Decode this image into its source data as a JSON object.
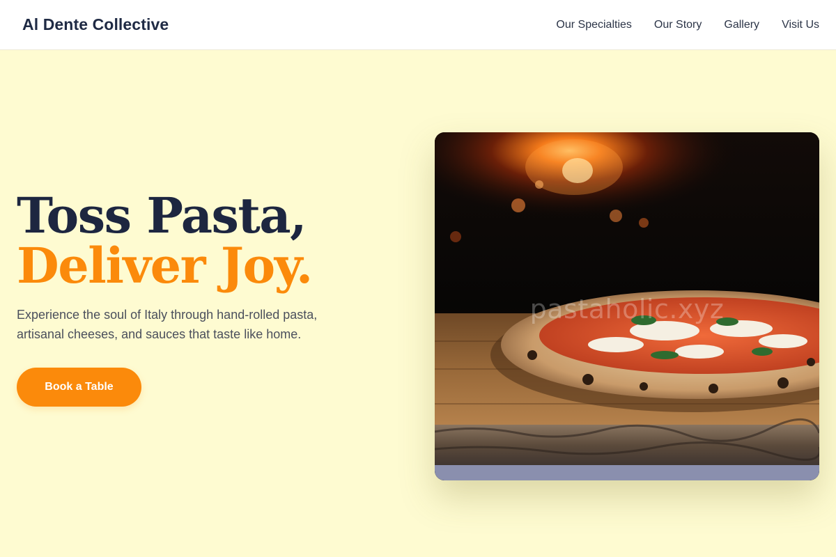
{
  "header": {
    "brand": "Al Dente Collective",
    "nav": [
      "Our Specialties",
      "Our Story",
      "Gallery",
      "Visit Us"
    ]
  },
  "hero": {
    "headline_line1": "Toss Pasta,",
    "headline_line2": "Deliver Joy.",
    "subtext": "Experience the soul of Italy through hand-rolled pasta, artisanal cheeses, and sauces that taste like home.",
    "cta_label": "Book a Table",
    "image_watermark": "pastaholic.xyz"
  },
  "colors": {
    "background": "#fefbd1",
    "accent": "#fb8a0b",
    "heading": "#1d2640"
  }
}
